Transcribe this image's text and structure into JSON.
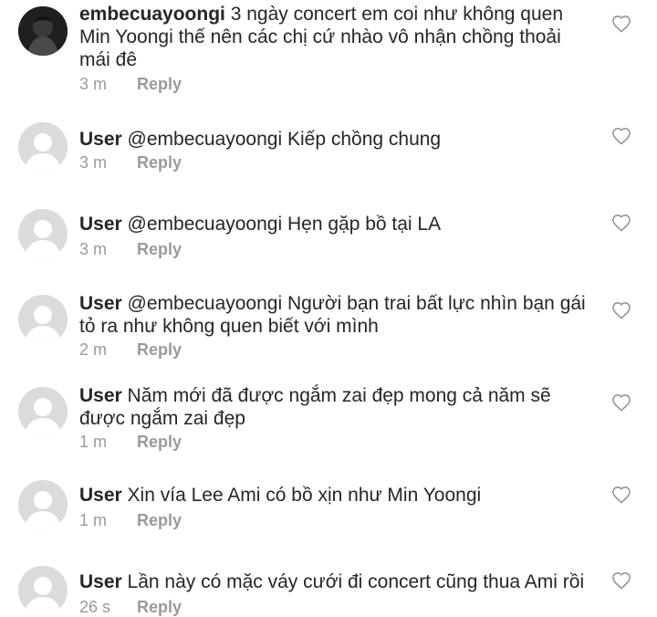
{
  "comments": [
    {
      "user": "embecuayoongi",
      "body": "3 ngày concert em coi như không quen Min Yoongi thế nên các chị cứ nhào vô nhận chồng thoải mái đê",
      "time": "3 m",
      "reply": "Reply",
      "avatar": "photo"
    },
    {
      "user": "User",
      "body": "@embecuayoongi Kiếp chồng chung",
      "time": "3 m",
      "reply": "Reply",
      "avatar": "default"
    },
    {
      "user": "User",
      "body": "@embecuayoongi Hẹn gặp bồ tại LA",
      "time": "3 m",
      "reply": "Reply",
      "avatar": "default"
    },
    {
      "user": "User",
      "body": "@embecuayoongi Người bạn trai bất lực nhìn bạn gái tỏ ra như không quen biết với mình",
      "time": "2 m",
      "reply": "Reply",
      "avatar": "default"
    },
    {
      "user": "User",
      "body": "Năm mới đã được ngắm zai đẹp mong cả năm sẽ được ngắm zai đẹp",
      "time": "1 m",
      "reply": "Reply",
      "avatar": "default"
    },
    {
      "user": "User",
      "body": "Xin vía Lee Ami có bồ xịn như Min Yoongi",
      "time": "1 m",
      "reply": "Reply",
      "avatar": "default"
    },
    {
      "user": "User",
      "body": "Lần này có mặc váy cưới đi concert cũng thua Ami rồi",
      "time": "26 s",
      "reply": "Reply",
      "avatar": "default"
    }
  ],
  "icons": {
    "like": "heart-outline-icon",
    "avatar_default": "default-avatar-icon"
  },
  "colors": {
    "text": "#262626",
    "meta": "#9a9a9a",
    "avatar_bg": "#dbdbdb"
  }
}
